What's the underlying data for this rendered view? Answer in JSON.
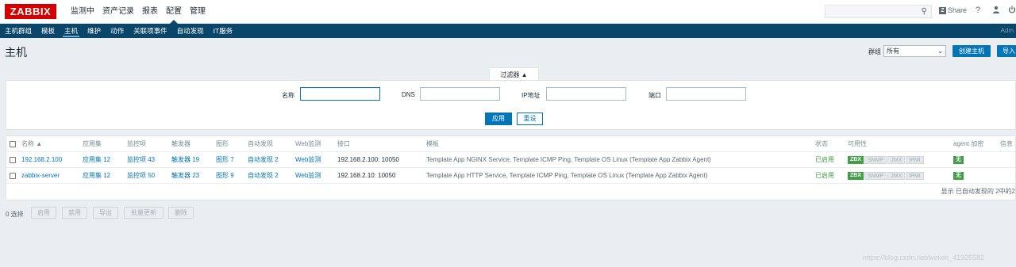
{
  "logo": "ZABBIX",
  "top_menu": [
    "监测中",
    "资产记录",
    "报表",
    "配置",
    "管理"
  ],
  "share": "Share",
  "help": "?",
  "sub_menu": [
    "主机群组",
    "模板",
    "主机",
    "维护",
    "动作",
    "关联项事件",
    "自动发现",
    "IT服务"
  ],
  "user": "Adm",
  "page_title": "主机",
  "group_label": "群组",
  "group_value": "所有",
  "create_host": "创建主机",
  "import": "导入",
  "filter": {
    "tab": "过滤器 ▲",
    "name_label": "名称",
    "dns_label": "DNS",
    "ip_label": "IP地址",
    "port_label": "端口",
    "apply": "应用",
    "reset": "重设"
  },
  "table": {
    "headers": {
      "name": "名称 ▲",
      "apps": "应用集",
      "items": "监控项",
      "triggers": "触发器",
      "graphs": "图形",
      "discovery": "自动发现",
      "web": "Web监测",
      "interface": "接口",
      "templates": "模板",
      "status": "状态",
      "availability": "可用性",
      "encryption": "agent 加密",
      "info": "信息"
    },
    "rows": [
      {
        "name": "192.168.2.100",
        "apps": "应用集 12",
        "items": "监控项 43",
        "triggers": "触发器 19",
        "graphs": "图形 7",
        "discovery": "自动发现 2",
        "web": "Web监测",
        "interface": "192.168.2.100: 10050",
        "templates": "Template App NGINX Service, Template ICMP Ping, Template OS Linux (Template App Zabbix Agent)",
        "status": "已启用",
        "zbx": "ZBX",
        "snmp": "SNMP",
        "jmx": "JMX",
        "ipmi": "IPMI",
        "encryption": "无"
      },
      {
        "name": "zabbix-server",
        "apps": "应用集 12",
        "items": "监控项 50",
        "triggers": "触发器 23",
        "graphs": "图形 9",
        "discovery": "自动发现 2",
        "web": "Web监测",
        "interface": "192.168.2.10: 10050",
        "templates": "Template App HTTP Service, Template ICMP Ping, Template OS Linux (Template App Zabbix Agent)",
        "status": "已启用",
        "zbx": "ZBX",
        "snmp": "SNMP",
        "jmx": "JMX",
        "ipmi": "IPMI",
        "encryption": "无"
      }
    ],
    "footer": "显示 已自动发现的 2中的2"
  },
  "selected": "0 选择",
  "actions": [
    "启用",
    "禁用",
    "导出",
    "批量更新",
    "删除"
  ],
  "watermark": "https://blog.csdn.net/weixin_41926582",
  "colors": {
    "brand": "#d40000",
    "nav": "#0a466a",
    "accent": "#0275b8",
    "ok": "#429e47"
  }
}
